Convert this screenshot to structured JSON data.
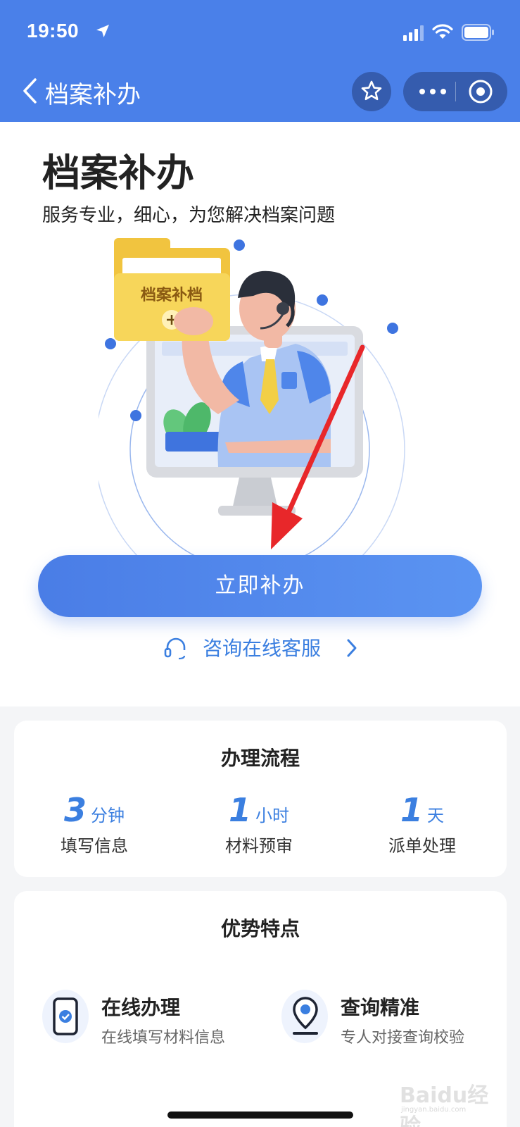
{
  "status_bar": {
    "time": "19:50"
  },
  "nav": {
    "title": "档案补办"
  },
  "hero": {
    "title": "档案补办",
    "subtitle": "服务专业，细心，为您解决档案问题",
    "folder_label": "档案补档",
    "primary_button": "立即补办",
    "consult_link": "咨询在线客服"
  },
  "process": {
    "title": "办理流程",
    "steps": [
      {
        "value": "3",
        "unit": "分钟",
        "label": "填写信息"
      },
      {
        "value": "1",
        "unit": "小时",
        "label": "材料预审"
      },
      {
        "value": "1",
        "unit": "天",
        "label": "派单处理"
      }
    ]
  },
  "advantages": {
    "title": "优势特点",
    "features": [
      {
        "title": "在线办理",
        "desc": "在线填写材料信息",
        "icon": "phone-check-icon"
      },
      {
        "title": "查询精准",
        "desc": "专人对接查询校验",
        "icon": "location-pin-icon"
      }
    ]
  },
  "watermark": {
    "brand": "Baidu经验",
    "url": "jingyan.baidu.com"
  },
  "colors": {
    "header": "#4a80e9",
    "accent": "#3b7fe0",
    "button_start": "#4a7de6",
    "button_end": "#5b94f2"
  }
}
